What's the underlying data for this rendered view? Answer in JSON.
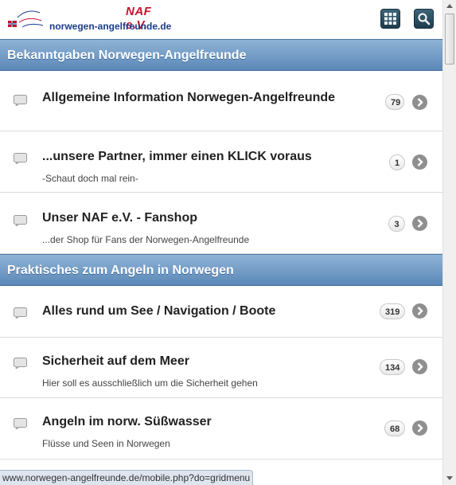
{
  "header": {
    "logo_naf": "NAF e.V.",
    "logo_url": "norwegen-angelfreunde.de",
    "grid_icon": "grid-menu-icon",
    "search_icon": "search-icon"
  },
  "sections": [
    {
      "title": "Bekanntgaben Norwegen-Angelfreunde",
      "forums": [
        {
          "title": "Allgemeine Information Norwegen-Angelfreunde",
          "description": "",
          "count": "79"
        },
        {
          "title": "...unsere Partner, immer einen KLICK voraus",
          "description": "-Schaut doch mal rein-",
          "count": "1"
        },
        {
          "title": "Unser NAF e.V. - Fanshop",
          "description": "...der Shop für Fans der Norwegen-Angelfreunde",
          "count": "3"
        }
      ]
    },
    {
      "title": "Praktisches zum Angeln in Norwegen",
      "forums": [
        {
          "title": "Alles rund um See / Navigation / Boote",
          "description": "",
          "count": "319"
        },
        {
          "title": "Sicherheit auf dem Meer",
          "description": "Hier soll es ausschließlich um die Sicherheit gehen",
          "count": "134"
        },
        {
          "title": "Angeln im norw. Süßwasser",
          "description": "Flüsse und Seen in Norwegen",
          "count": "68"
        }
      ]
    }
  ],
  "status_bar": {
    "url": "www.norwegen-angelfreunde.de/mobile.php?do=gridmenu"
  },
  "colors": {
    "section_header": "#6f98c4",
    "title_text": "#222222",
    "arrow": "#8f8f8f"
  }
}
